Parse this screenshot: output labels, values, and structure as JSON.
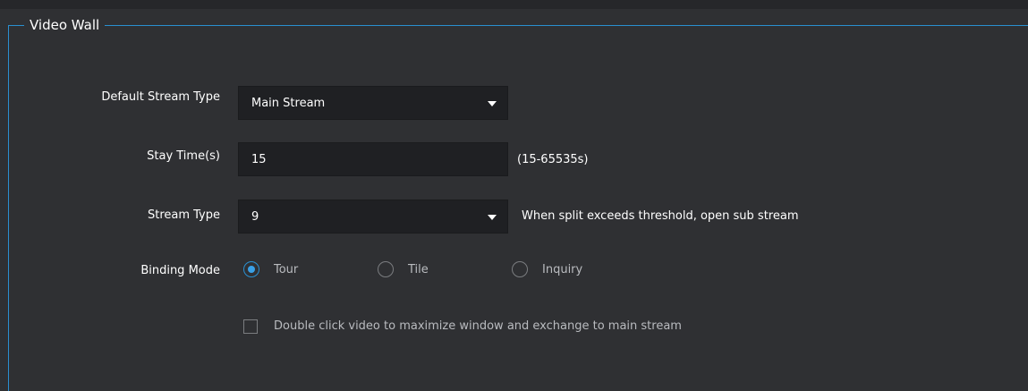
{
  "section": {
    "title": "Video Wall"
  },
  "default_stream_type": {
    "label": "Default Stream Type",
    "selected": "Main Stream"
  },
  "stay_time": {
    "label": "Stay Time(s)",
    "value": "15",
    "range_hint": "(15-65535s)"
  },
  "stream_type": {
    "label": "Stream Type",
    "selected": "9",
    "hint": "When split exceeds threshold, open sub stream"
  },
  "binding_mode": {
    "label": "Binding Mode",
    "options": [
      {
        "label": "Tour",
        "checked": true
      },
      {
        "label": "Tile",
        "checked": false
      },
      {
        "label": "Inquiry",
        "checked": false
      }
    ]
  },
  "double_click": {
    "label": "Double click video to maximize window and exchange to main stream",
    "checked": false
  },
  "colors": {
    "background": "#2f3033",
    "field_background": "#1f2023",
    "accent": "#2a8fd0",
    "text": "#ffffff",
    "secondary_text": "#b9bbbf"
  }
}
